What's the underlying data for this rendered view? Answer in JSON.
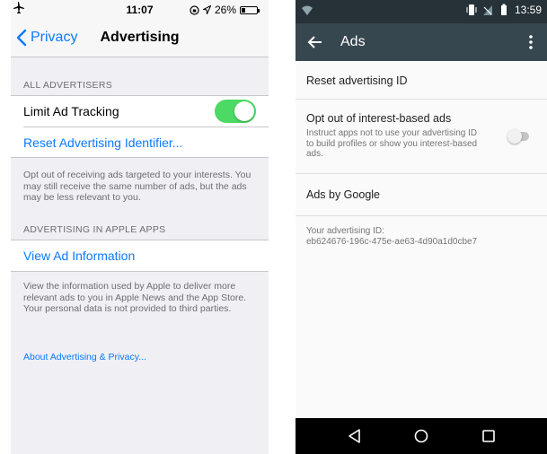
{
  "ios": {
    "status": {
      "time": "11:07",
      "battery": "26%",
      "battery_level": 0.26
    },
    "nav": {
      "back_label": "Privacy",
      "title": "Advertising"
    },
    "section1_header": "ALL ADVERTISERS",
    "limit_ad_tracking": {
      "label": "Limit Ad Tracking",
      "on": true
    },
    "reset_label": "Reset Advertising Identifier...",
    "section1_footer": "Opt out of receiving ads targeted to your interests. You may still receive the same number of ads, but the ads may be less relevant to you.",
    "section2_header": "ADVERTISING IN APPLE APPS",
    "view_ad_info_label": "View Ad Information",
    "section2_footer": "View the information used by Apple to deliver more relevant ads to you in Apple News and the App Store. Your personal data is not provided to third parties.",
    "about_link": "About Advertising & Privacy..."
  },
  "android": {
    "status": {
      "time": "13:59"
    },
    "toolbar": {
      "title": "Ads"
    },
    "reset_id": "Reset advertising ID",
    "opt_out": {
      "title": "Opt out of interest-based ads",
      "summary": "Instruct apps not to use your advertising ID to build profiles or show you interest-based ads.",
      "enabled": false
    },
    "ads_by_google": "Ads by Google",
    "ad_id_label": "Your advertising ID:",
    "ad_id_value": "eb624676-196c-475e-ae63-4d90a1d0cbe7"
  },
  "colors": {
    "ios_blue": "#0a7aff",
    "ios_green": "#4cd964",
    "android_toolbar": "#37474f",
    "android_status": "#263238"
  }
}
